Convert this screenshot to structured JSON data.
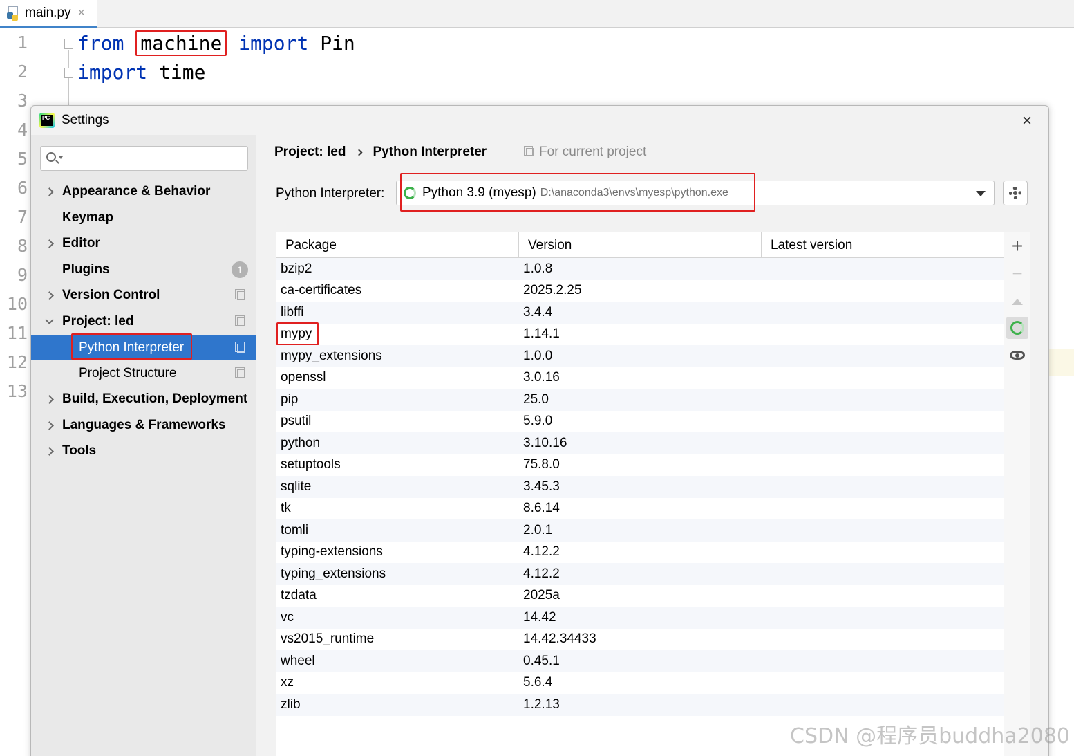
{
  "editor": {
    "tab_label": "main.py",
    "tab_close": "×",
    "line_numbers": [
      "1",
      "2",
      "3",
      "4",
      "5",
      "6",
      "7",
      "8",
      "9",
      "10",
      "11",
      "12",
      "13"
    ],
    "code": {
      "line1": {
        "kw1": "from",
        "module": "machine",
        "kw2": "import",
        "name": "Pin"
      },
      "line2": {
        "kw": "import",
        "name": "time"
      }
    }
  },
  "dialog": {
    "title": "Settings",
    "close": "×",
    "sidebar": {
      "items": [
        {
          "label": "Appearance & Behavior"
        },
        {
          "label": "Keymap"
        },
        {
          "label": "Editor"
        },
        {
          "label": "Plugins",
          "badge": "1"
        },
        {
          "label": "Version Control"
        },
        {
          "label": "Project: led"
        },
        {
          "label": "Python Interpreter"
        },
        {
          "label": "Project Structure"
        },
        {
          "label": "Build, Execution, Deployment"
        },
        {
          "label": "Languages & Frameworks"
        },
        {
          "label": "Tools"
        }
      ]
    },
    "breadcrumb": {
      "project": "Project: led",
      "page": "Python Interpreter"
    },
    "for_current_project": "For current project",
    "interpreter": {
      "label": "Python Interpreter:",
      "name": "Python 3.9 (myesp)",
      "path": "D:\\anaconda3\\envs\\myesp\\python.exe"
    },
    "table": {
      "headers": {
        "package": "Package",
        "version": "Version",
        "latest": "Latest version"
      },
      "rows": [
        {
          "package": "bzip2",
          "version": "1.0.8"
        },
        {
          "package": "ca-certificates",
          "version": "2025.2.25"
        },
        {
          "package": "libffi",
          "version": "3.4.4"
        },
        {
          "package": "mypy",
          "version": "1.14.1"
        },
        {
          "package": "mypy_extensions",
          "version": "1.0.0"
        },
        {
          "package": "openssl",
          "version": "3.0.16"
        },
        {
          "package": "pip",
          "version": "25.0"
        },
        {
          "package": "psutil",
          "version": "5.9.0"
        },
        {
          "package": "python",
          "version": "3.10.16"
        },
        {
          "package": "setuptools",
          "version": "75.8.0"
        },
        {
          "package": "sqlite",
          "version": "3.45.3"
        },
        {
          "package": "tk",
          "version": "8.6.14"
        },
        {
          "package": "tomli",
          "version": "2.0.1"
        },
        {
          "package": "typing-extensions",
          "version": "4.12.2"
        },
        {
          "package": "typing_extensions",
          "version": "4.12.2"
        },
        {
          "package": "tzdata",
          "version": "2025a"
        },
        {
          "package": "vc",
          "version": "14.42"
        },
        {
          "package": "vs2015_runtime",
          "version": "14.42.34433"
        },
        {
          "package": "wheel",
          "version": "0.45.1"
        },
        {
          "package": "xz",
          "version": "5.6.4"
        },
        {
          "package": "zlib",
          "version": "1.2.13"
        }
      ]
    },
    "tools": {
      "add": "+",
      "remove": "−"
    }
  },
  "watermark": "CSDN @程序员buddha2080",
  "colors": {
    "selection": "#2f76cc",
    "highlight_box": "#e02020",
    "keyword": "#0033b3"
  }
}
